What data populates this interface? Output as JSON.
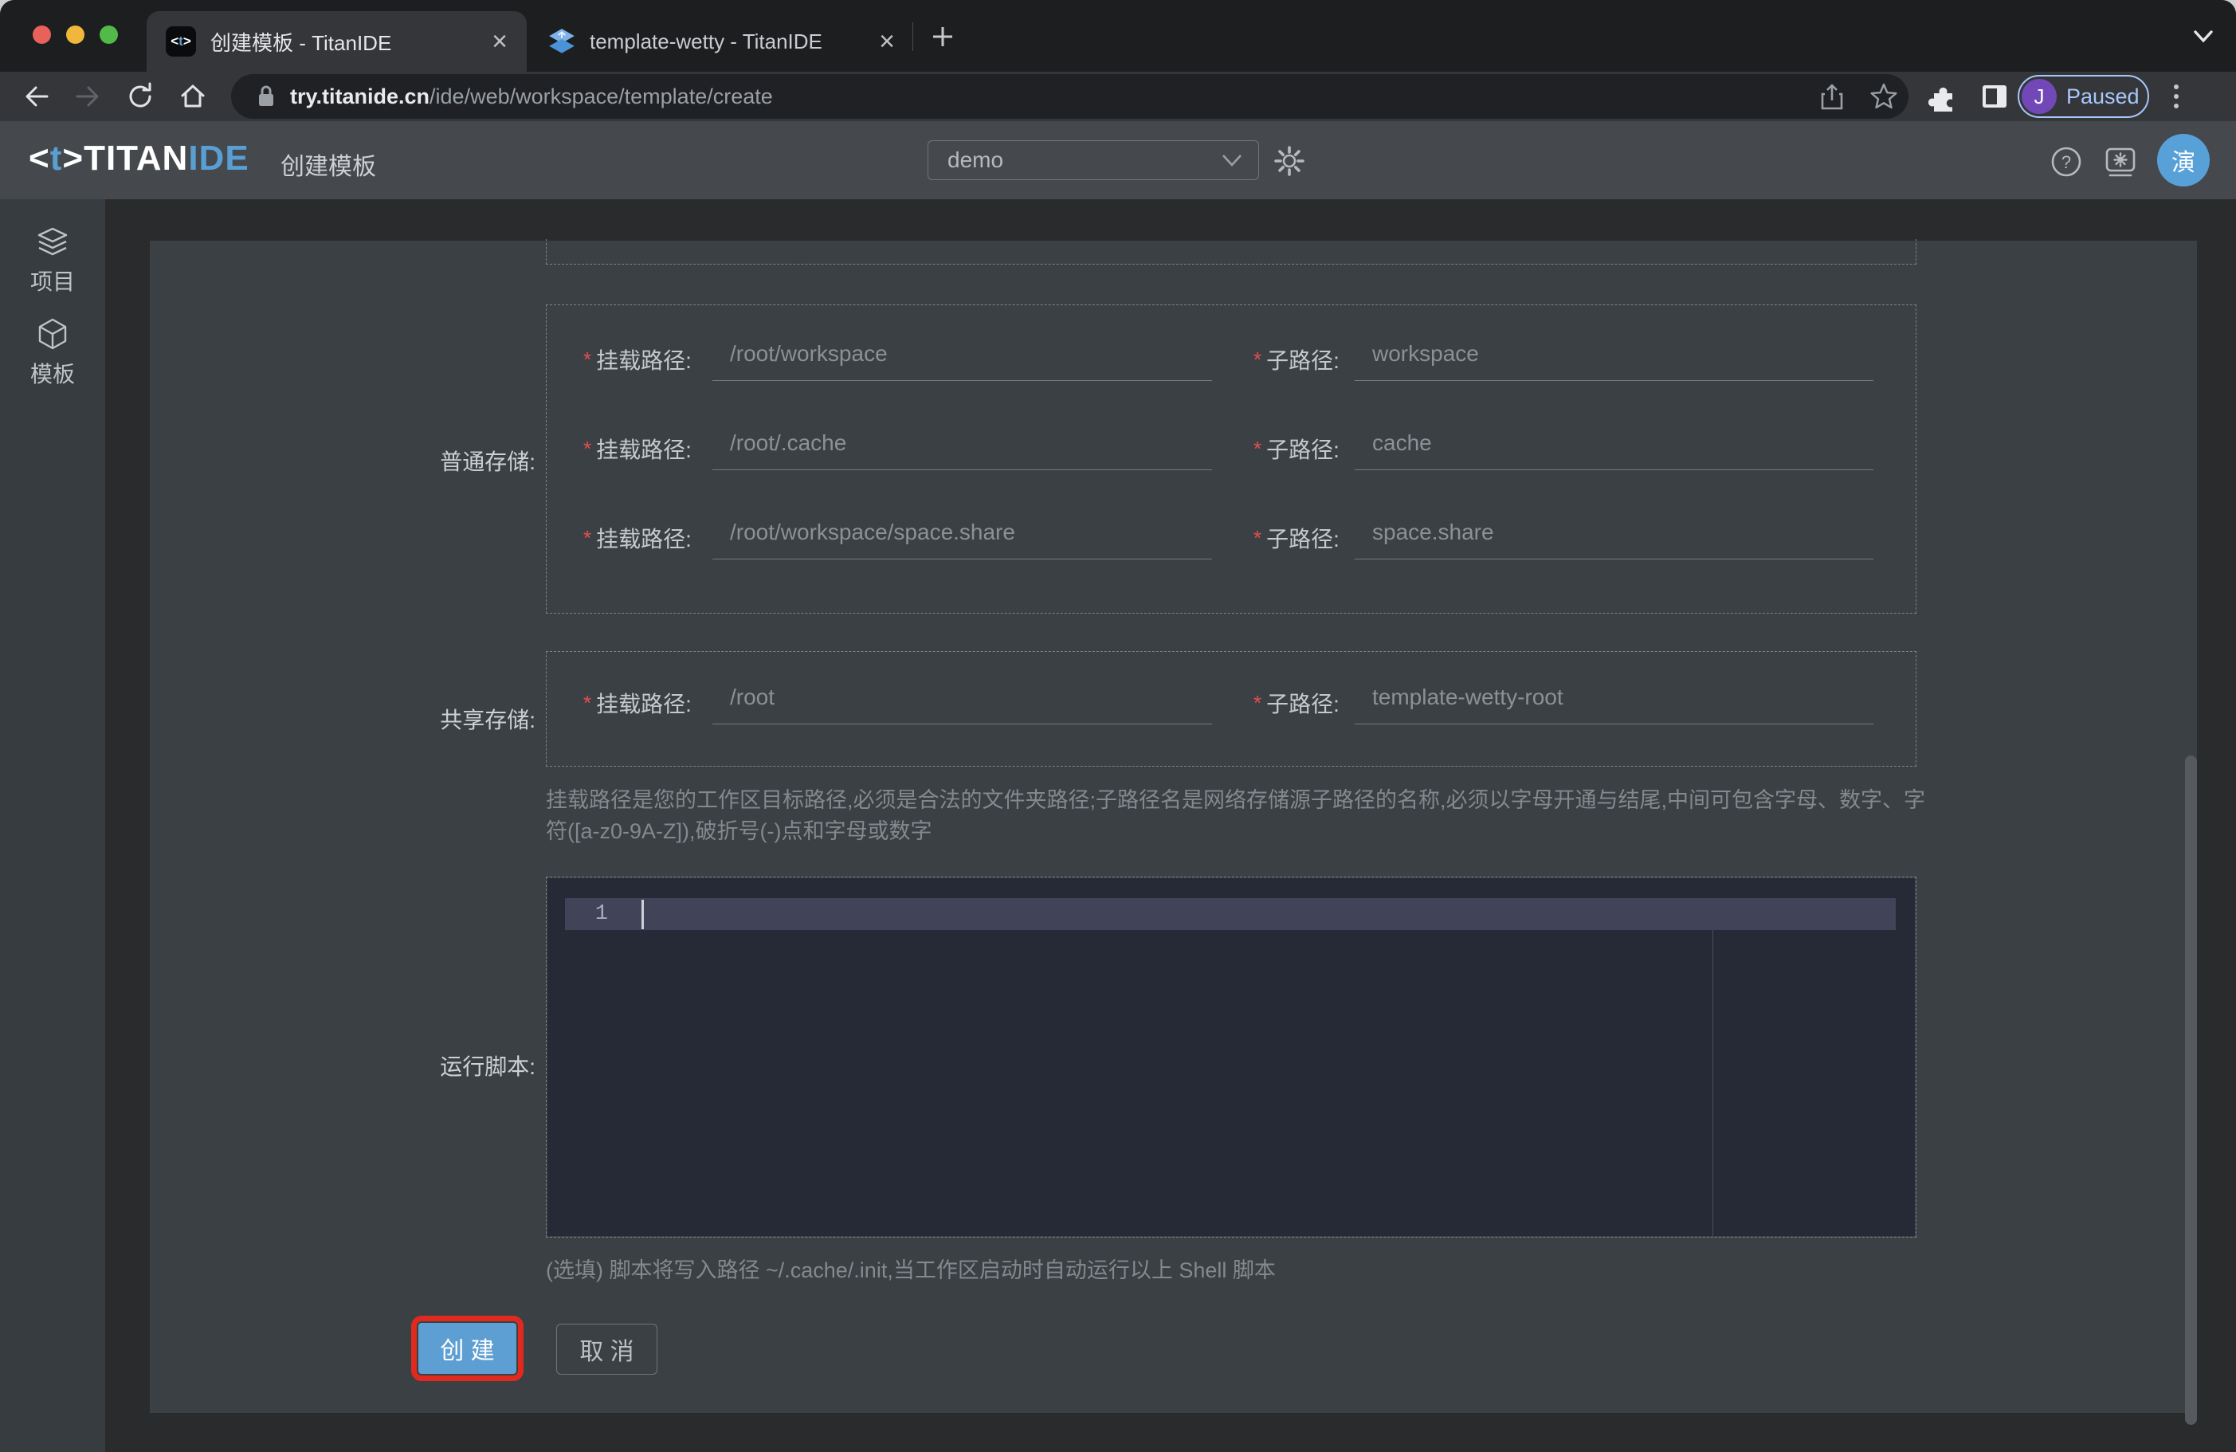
{
  "browser": {
    "tabs": [
      {
        "title": "创建模板 - TitanIDE"
      },
      {
        "title": "template-wetty - TitanIDE"
      }
    ],
    "url": {
      "host": "try.titanide.cn",
      "path": "/ide/web/workspace/template/create"
    },
    "profile": {
      "initial": "J",
      "label": "Paused"
    }
  },
  "header": {
    "logo": {
      "open": "<",
      "t": "t",
      "close": ">",
      "titan": "TITAN",
      "ide": "IDE"
    },
    "page_title": "创建模板",
    "workspace_select": {
      "value": "demo"
    },
    "avatar": "演"
  },
  "sidebar": {
    "items": [
      {
        "label": "项目"
      },
      {
        "label": "模板"
      }
    ]
  },
  "form": {
    "required_mark": "*",
    "normal_storage": {
      "label": "普通存储:",
      "rows": [
        {
          "mount_label": "挂载路径:",
          "mount_value": "/root/workspace",
          "sub_label": "子路径:",
          "sub_value": "workspace"
        },
        {
          "mount_label": "挂载路径:",
          "mount_value": "/root/.cache",
          "sub_label": "子路径:",
          "sub_value": "cache"
        },
        {
          "mount_label": "挂载路径:",
          "mount_value": "/root/workspace/space.share",
          "sub_label": "子路径:",
          "sub_value": "space.share"
        }
      ]
    },
    "shared_storage": {
      "label": "共享存储:",
      "rows": [
        {
          "mount_label": "挂载路径:",
          "mount_value": "/root",
          "sub_label": "子路径:",
          "sub_value": "template-wetty-root"
        }
      ]
    },
    "path_hint": "挂载路径是您的工作区目标路径,必须是合法的文件夹路径;子路径名是网络存储源子路径的名称,必须以字母开通与结尾,中间可包含字母、数字、字符([a-z0-9A-Z]),破折号(-)点和字母或数字",
    "script": {
      "label": "运行脚本:",
      "line_number": "1",
      "note": "(选填) 脚本将写入路径 ~/.cache/.init,当工作区启动时自动运行以上 Shell 脚本"
    },
    "create_label": "创 建",
    "cancel_label": "取 消"
  },
  "colors": {
    "accent_blue": "#5d9fd3",
    "annotation_red": "#e12a1d",
    "paused_blue": "#a8c7fa",
    "profile_purple": "#7248b9",
    "avatar_blue": "#58a1d8",
    "panel_bg": "#3b4045",
    "editor_bg": "#262a36",
    "editor_active_line": "#414459"
  }
}
